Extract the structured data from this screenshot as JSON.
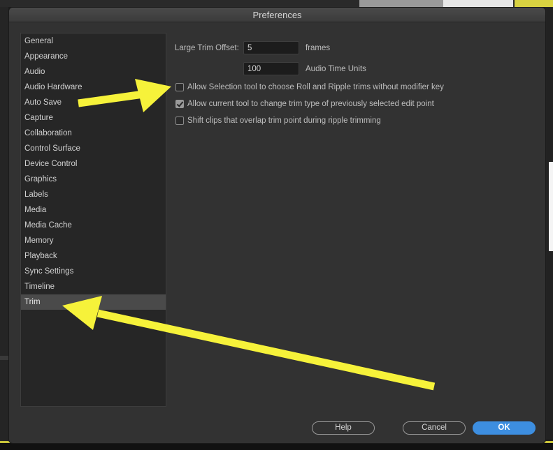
{
  "dialog": {
    "title": "Preferences"
  },
  "categories": [
    "General",
    "Appearance",
    "Audio",
    "Audio Hardware",
    "Auto Save",
    "Capture",
    "Collaboration",
    "Control Surface",
    "Device Control",
    "Graphics",
    "Labels",
    "Media",
    "Media Cache",
    "Memory",
    "Playback",
    "Sync Settings",
    "Timeline",
    "Trim"
  ],
  "selected_category": "Trim",
  "trim": {
    "large_trim_offset_label": "Large Trim Offset:",
    "frames_value": "5",
    "frames_unit": "frames",
    "audio_value": "100",
    "audio_unit": "Audio Time Units",
    "options": [
      {
        "label": "Allow Selection tool to choose Roll and Ripple trims without modifier key",
        "checked": false
      },
      {
        "label": "Allow current tool to change trim type of previously selected edit point",
        "checked": true
      },
      {
        "label": "Shift clips that overlap trim point during ripple trimming",
        "checked": false
      }
    ]
  },
  "buttons": {
    "help": "Help",
    "cancel": "Cancel",
    "ok": "OK"
  },
  "colors": {
    "accent": "#3d8ee0",
    "annotation_arrow": "#f6f23a"
  }
}
